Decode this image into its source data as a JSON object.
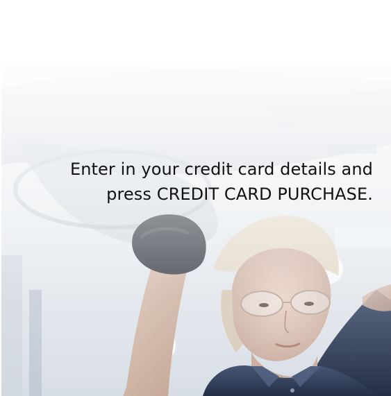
{
  "instruction": {
    "line1": "Enter in your credit card details and",
    "line2": "press CREDIT CARD PURCHASE."
  },
  "hero": {
    "background_color": "#e5e9ee",
    "shirt_color": "#2d3b55",
    "glove_color": "#3b4048"
  }
}
